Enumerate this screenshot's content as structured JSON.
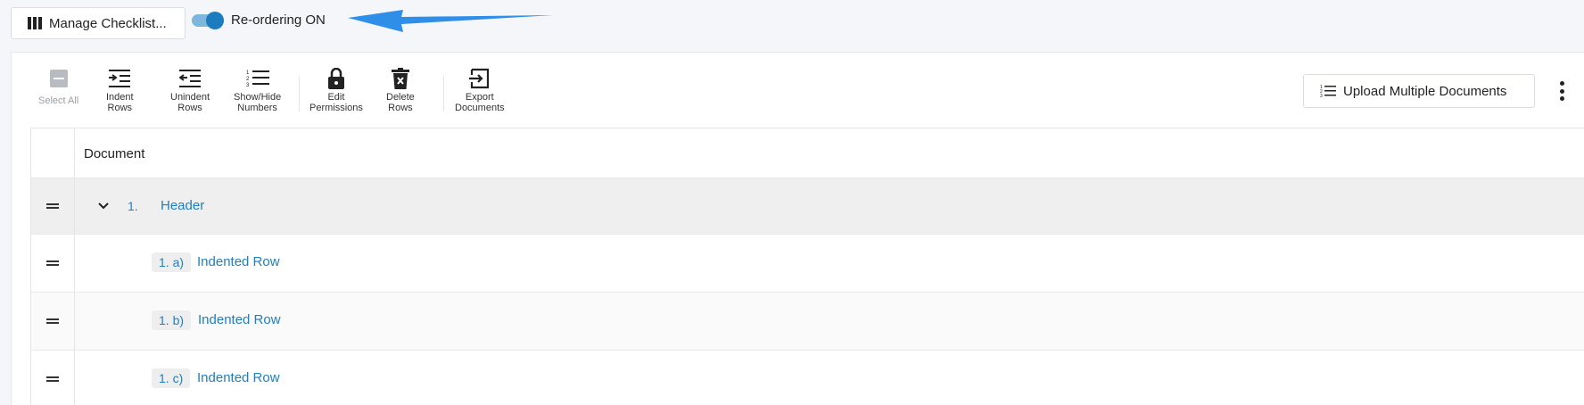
{
  "topbar": {
    "manage_label": "Manage Checklist...",
    "toggle_label": "Re-ordering ON",
    "toggle_on": true
  },
  "toolbar": {
    "select_all": "Select All",
    "indent_1": "Indent",
    "indent_2": "Rows",
    "unindent_1": "Unindent",
    "unindent_2": "Rows",
    "showhide_1": "Show/Hide",
    "showhide_2": "Numbers",
    "edit_1": "Edit",
    "edit_2": "Permissions",
    "delete_1": "Delete",
    "delete_2": "Rows",
    "export_1": "Export",
    "export_2": "Documents",
    "upload_label": "Upload Multiple Documents"
  },
  "table": {
    "column_header": "Document",
    "header_row": {
      "number": "1.",
      "label": "Header"
    },
    "rows": [
      {
        "number": "1. a)",
        "label": "Indented Row"
      },
      {
        "number": "1. b)",
        "label": "Indented Row"
      },
      {
        "number": "1. c)",
        "label": "Indented Row"
      }
    ]
  },
  "colors": {
    "accent": "#1f7fbf",
    "toggle_track": "#7fb7dc",
    "arrow": "#2f8ee8"
  },
  "icons": [
    "columns-icon",
    "toggle-switch",
    "annotation-arrow",
    "select-all-checkbox-icon",
    "indent-icon",
    "unindent-icon",
    "numbered-list-icon",
    "lock-icon",
    "delete-icon",
    "export-icon",
    "list-icon",
    "kebab-menu-icon",
    "drag-handle-icon",
    "chevron-down-icon"
  ]
}
